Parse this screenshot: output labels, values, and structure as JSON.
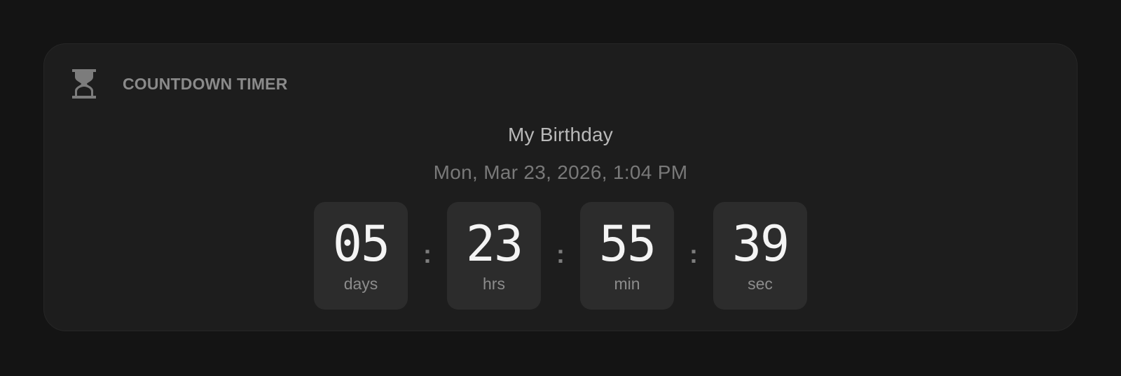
{
  "widget": {
    "icon": "hourglass-icon",
    "title": "COUNTDOWN TIMER"
  },
  "event": {
    "name": "My Birthday",
    "datetime": "Mon, Mar 23, 2026, 1:04 PM"
  },
  "countdown": {
    "separator": ":",
    "units": [
      {
        "value": "05",
        "label": "days"
      },
      {
        "value": "23",
        "label": "hrs"
      },
      {
        "value": "55",
        "label": "min"
      },
      {
        "value": "39",
        "label": "sec"
      }
    ]
  },
  "colors": {
    "page_background": "#141414",
    "card_background": "#1d1d1d",
    "tile_background": "#2c2c2c",
    "digit_color": "#f4f4f4",
    "muted_text": "#8a8a8a"
  }
}
